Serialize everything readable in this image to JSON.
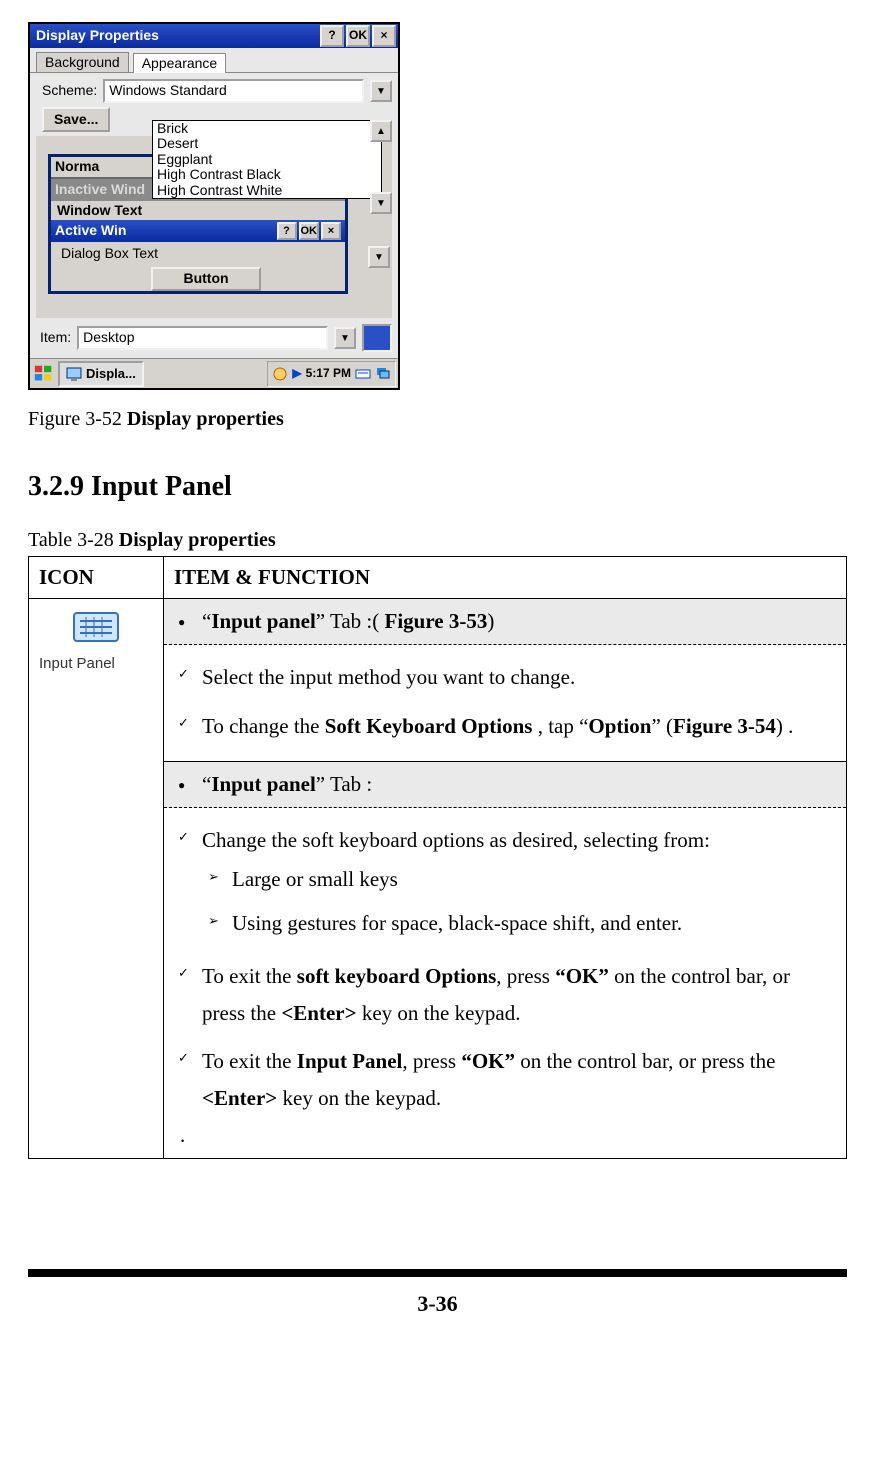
{
  "screenshot": {
    "title": "Display Properties",
    "help_btn": "?",
    "ok_btn": "OK",
    "close_btn": "×",
    "tabs": {
      "background": "Background",
      "appearance": "Appearance"
    },
    "scheme_label": "Scheme:",
    "scheme_value": "Windows Standard",
    "save_btn": "Save...",
    "dropdown_arrow": "▼",
    "scroll_up": "▲",
    "scroll_down": "▼",
    "scheme_options": [
      "Brick",
      "Desert",
      "Eggplant",
      "High Contrast Black",
      "High Contrast White"
    ],
    "preview": {
      "normal": "Norma",
      "inactive": "Inactive Wind",
      "window_text": "Window Text",
      "active": "Active Win",
      "dialog": "Dialog Box Text",
      "button": "Button",
      "ok": "OK",
      "close": "×",
      "help": "?"
    },
    "item_label": "Item:",
    "item_value": "Desktop",
    "taskbar": {
      "app": "Displa...",
      "time": "5:17 PM"
    }
  },
  "figure_caption_prefix": "Figure 3-52 ",
  "figure_caption_bold": "Display properties",
  "section_heading": "3.2.9 Input Panel",
  "table_caption_prefix": "Table 3-28 ",
  "table_caption_bold": "Display properties",
  "table": {
    "header_icon": "ICON",
    "header_item": "ITEM & FUNCTION",
    "icon_label": "Input Panel",
    "row1": {
      "heading_open": "“",
      "heading_bold": "Input panel",
      "heading_mid": "” Tab",
      "heading_after": " :( ",
      "heading_ref": "Figure 3-53",
      "heading_close": ")",
      "item1": "Select the input method you want to change.",
      "item2_pre": "To change the ",
      "item2_b1": "Soft Keyboard Options",
      "item2_mid": " , tap “",
      "item2_b2": "Option",
      "item2_mid2": "” (",
      "item2_b3": "Figure 3-54",
      "item2_end": ") ."
    },
    "row2": {
      "heading_open": "“",
      "heading_bold": "Input panel",
      "heading_mid": "” Tab",
      "heading_after": " :",
      "item1": "Change the soft keyboard options as desired, selecting from:",
      "sub1": "Large or small keys",
      "sub2": "Using gestures for space, black-space shift, and enter.",
      "item2_pre": "To exit the ",
      "item2_b1": "soft keyboard Options",
      "item2_mid": ", press ",
      "item2_b2": "“OK”",
      "item2_mid2": " on the control bar, or press the ",
      "item2_b3": "<Enter>",
      "item2_end": " key on the keypad.",
      "item3_pre": "To exit the ",
      "item3_b1": "Input Panel",
      "item3_mid": ", press ",
      "item3_b2": "“OK”",
      "item3_mid2": " on the control bar, or press the ",
      "item3_b3": "<Enter>",
      "item3_end": " key on the keypad.",
      "trailing_dot": "."
    }
  },
  "page_number": "3-36"
}
